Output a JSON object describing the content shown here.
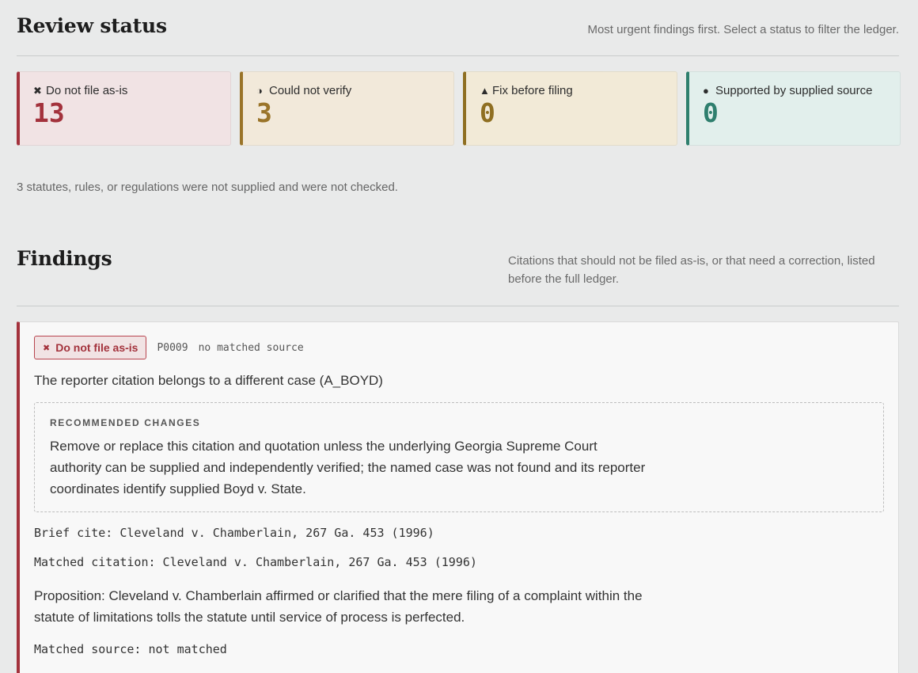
{
  "review_status": {
    "title": "Review status",
    "note": "Most urgent findings first. Select a status to filter the ledger.",
    "cards": [
      {
        "glyph": "✖",
        "icon": "x-icon",
        "label": "Do not file as-is",
        "count": "13",
        "color": "#a3323c"
      },
      {
        "glyph": "◑",
        "icon": "half-circle-icon",
        "label": "Could not verify",
        "count": "3",
        "color": "#9a7429"
      },
      {
        "glyph": "▲",
        "icon": "triangle-icon",
        "label": "Fix before filing",
        "count": "0",
        "color": "#8f6f22"
      },
      {
        "glyph": "●",
        "icon": "dot-icon",
        "label": "Supported by supplied source",
        "count": "0",
        "color": "#2f7f6e"
      }
    ],
    "not_checked": "3 statutes, rules, or regulations were not supplied and were not checked."
  },
  "findings": {
    "title": "Findings",
    "note": "Citations that should not be filed as-is, or that need a correction, listed before the full ledger.",
    "items": [
      {
        "badge_glyph": "✖",
        "badge": "Do not file as-is",
        "id": "P0009",
        "source_state": "no matched source",
        "summary": "The reporter citation belongs to a different case (A_BOYD)",
        "recommended_label": "RECOMMENDED CHANGES",
        "recommended_text": "Remove or replace this citation and quotation unless the underlying Georgia Supreme Court authority can be supplied and independently verified; the named case was not found and its reporter coordinates identify supplied Boyd v. State.",
        "brief_cite": "Brief cite: Cleveland v. Chamberlain, 267 Ga. 453 (1996)",
        "matched_citation": "Matched citation: Cleveland v. Chamberlain, 267 Ga. 453 (1996)",
        "proposition": "Proposition: Cleveland v. Chamberlain affirmed or clarified that the mere filing of a complaint within the statute of limitations tolls the statute until service of process is perfected.",
        "matched_source": "Matched source: not matched"
      }
    ]
  }
}
